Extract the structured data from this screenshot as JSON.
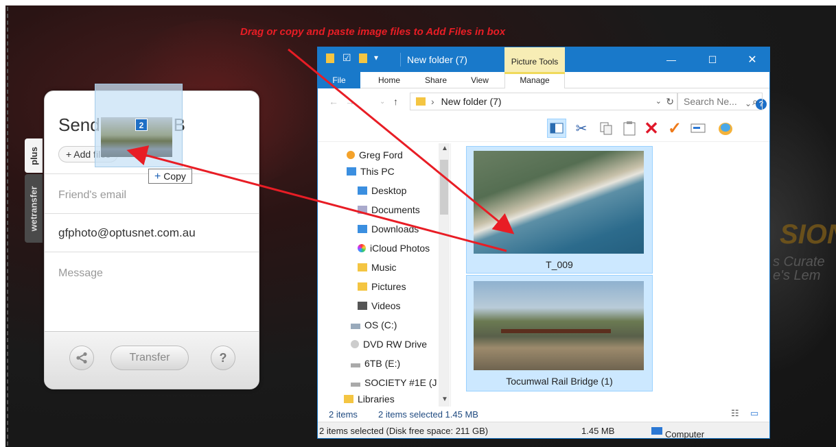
{
  "headline": "Drag or copy and paste image files to Add Files in box",
  "background": {
    "text1": "SIONAR",
    "text2a": "s Curate",
    "text2b": "e's Lem"
  },
  "wetransfer": {
    "tab_plus": "plus",
    "tab_brand": "wetransfer",
    "title": "Send up to 2GB",
    "add_files": "+ Add files",
    "friends_email_placeholder": "Friend's email",
    "your_email": "gfphoto@optusnet.com.au",
    "message_placeholder": "Message",
    "transfer_label": "Transfer",
    "help_label": "?"
  },
  "drag": {
    "count": "2",
    "copy_label": "Copy"
  },
  "explorer": {
    "title": "New folder (7)",
    "picture_tools": "Picture Tools",
    "ribbon_tabs": [
      "File",
      "Home",
      "Share",
      "View",
      "Manage"
    ],
    "address": "New folder (7)",
    "search_placeholder": "Search Ne...",
    "nav_items": [
      {
        "label": "Greg Ford",
        "icon": "user-icon"
      },
      {
        "label": "This PC",
        "icon": "pc-icon"
      },
      {
        "label": "Desktop",
        "icon": "folder-icon"
      },
      {
        "label": "Documents",
        "icon": "documents-icon"
      },
      {
        "label": "Downloads",
        "icon": "downloads-icon"
      },
      {
        "label": "iCloud Photos",
        "icon": "icloud-icon"
      },
      {
        "label": "Music",
        "icon": "music-icon"
      },
      {
        "label": "Pictures",
        "icon": "pictures-icon"
      },
      {
        "label": "Videos",
        "icon": "videos-icon"
      },
      {
        "label": "OS (C:)",
        "icon": "drive-icon"
      },
      {
        "label": "DVD RW Drive",
        "icon": "dvd-icon"
      },
      {
        "label": "6TB (E:)",
        "icon": "drive-icon"
      },
      {
        "label": "SOCIETY #1E (J",
        "icon": "drive-icon"
      },
      {
        "label": "Libraries",
        "icon": "folder-icon"
      }
    ],
    "files": [
      {
        "name": "T_009"
      },
      {
        "name": "Tocumwal Rail Bridge (1)"
      }
    ],
    "status": {
      "items": "2 items",
      "selected": "2 items selected  1.45 MB",
      "detail": "2 items selected (Disk free space: 211 GB)",
      "size": "1.45 MB",
      "location": "Computer"
    }
  }
}
